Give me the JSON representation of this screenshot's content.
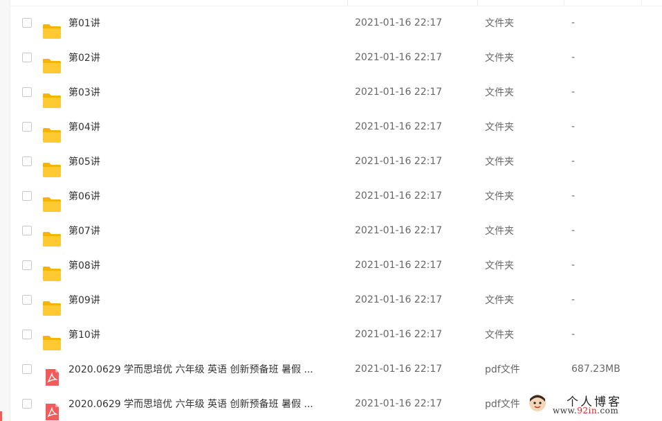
{
  "files": [
    {
      "name": "第01讲",
      "date": "2021-01-16 22:17",
      "type": "文件夹",
      "size": "-",
      "icon": "folder-icon"
    },
    {
      "name": "第02讲",
      "date": "2021-01-16 22:17",
      "type": "文件夹",
      "size": "-",
      "icon": "folder-icon"
    },
    {
      "name": "第03讲",
      "date": "2021-01-16 22:17",
      "type": "文件夹",
      "size": "-",
      "icon": "folder-icon"
    },
    {
      "name": "第04讲",
      "date": "2021-01-16 22:17",
      "type": "文件夹",
      "size": "-",
      "icon": "folder-icon"
    },
    {
      "name": "第05讲",
      "date": "2021-01-16 22:17",
      "type": "文件夹",
      "size": "-",
      "icon": "folder-icon"
    },
    {
      "name": "第06讲",
      "date": "2021-01-16 22:17",
      "type": "文件夹",
      "size": "-",
      "icon": "folder-icon"
    },
    {
      "name": "第07讲",
      "date": "2021-01-16 22:17",
      "type": "文件夹",
      "size": "-",
      "icon": "folder-icon"
    },
    {
      "name": "第08讲",
      "date": "2021-01-16 22:17",
      "type": "文件夹",
      "size": "-",
      "icon": "folder-icon"
    },
    {
      "name": "第09讲",
      "date": "2021-01-16 22:17",
      "type": "文件夹",
      "size": "-",
      "icon": "folder-icon"
    },
    {
      "name": "第10讲",
      "date": "2021-01-16 22:17",
      "type": "文件夹",
      "size": "-",
      "icon": "folder-icon"
    },
    {
      "name": "2020.0629 学而思培优  六年级  英语  创新预备班  暑假 ...",
      "date": "2021-01-16 22:17",
      "type": "pdf文件",
      "size": "687.23MB",
      "icon": "pdf-icon"
    },
    {
      "name": "2020.0629 学而思培优  六年级  英语  创新预备班  暑假 ...",
      "date": "2021-01-16 22:17",
      "type": "pdf文件",
      "size": "",
      "icon": "pdf-icon"
    }
  ],
  "watermark": {
    "title": "个人博客",
    "url_prefix": "www.",
    "url_highlight": "92in",
    "url_suffix": ".com"
  },
  "colors": {
    "folder": "#ffc933",
    "folder_tab": "#f5b400",
    "pdf": "#f15b5b",
    "accent": "#f25c54"
  }
}
